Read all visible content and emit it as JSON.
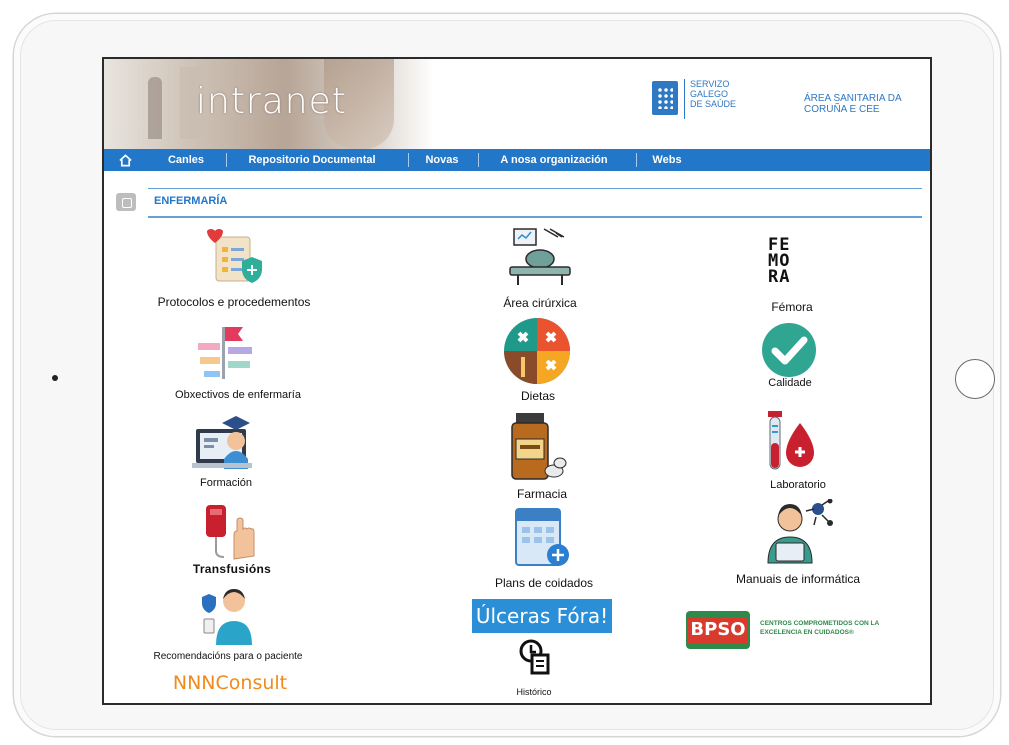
{
  "header": {
    "logo_text": "intranet",
    "sergas_text": "SERVIZO\nGALEGO\nDE SAÚDE",
    "area_text": "ÁREA SANITARIA DA\nCORUÑA E CEE"
  },
  "nav": {
    "home_icon": "home-icon",
    "items": [
      "Canles",
      "Repositorio Documental",
      "Novas",
      "A nosa organización",
      "Webs"
    ]
  },
  "section": {
    "title": "ENFERMARÍA"
  },
  "tiles": {
    "protocolos": "Protocolos e procedementos",
    "area_cirurxica": "Área cirúrxica",
    "femora": "Fémora",
    "femora_logo": "FE\nMO\nRA",
    "obxectivos": "Obxectivos de enfermaría",
    "dietas": "Dietas",
    "calidade": "Calidade",
    "formacion": "Formación",
    "farmacia": "Farmacia",
    "laboratorio": "Laboratorio",
    "transfusions": "Transfusións",
    "plans": "Plans de coidados",
    "manuais": "Manuais de informática",
    "recomendacions": "Recomendacións para o paciente",
    "ulceras": "Úlceras Fóra!",
    "bpso": "BPSO",
    "bpso_text": "CENTROS COMPROMETIDOS CON LA\nEXCELENCIA EN CUIDADOS®",
    "nnnconsult": "NNNConsult",
    "historico": "Histórico"
  },
  "colors": {
    "nav_blue": "#2377c9",
    "bpso_red": "#d83a2b",
    "bpso_green": "#2e8a4a",
    "nnn_orange": "#f08a1c"
  }
}
